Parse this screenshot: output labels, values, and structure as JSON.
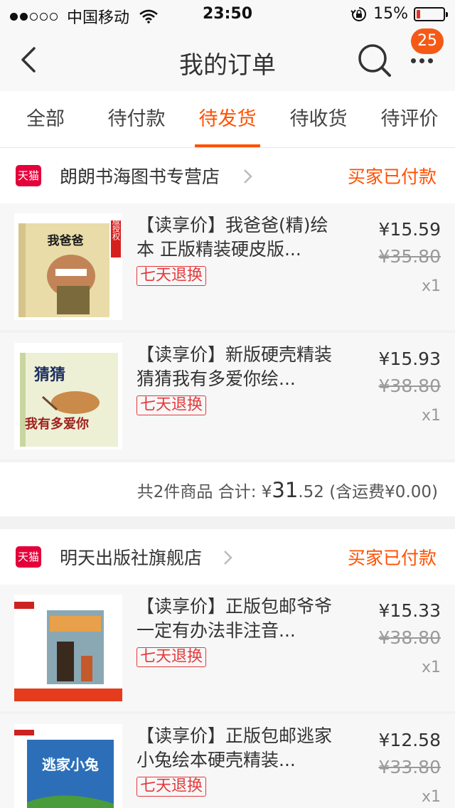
{
  "status_bar": {
    "carrier": "中国移动",
    "time": "23:50",
    "battery_percent": "15%",
    "battery_level": 0.15,
    "icons": [
      "signal-dots-icon",
      "wifi-icon",
      "rotation-lock-icon",
      "battery-icon"
    ]
  },
  "nav": {
    "title": "我的订单",
    "badge_count": "25",
    "icons": [
      "back-chevron-icon",
      "search-icon",
      "more-icon"
    ]
  },
  "tabs": [
    {
      "label": "全部",
      "active": false
    },
    {
      "label": "待付款",
      "active": false
    },
    {
      "label": "待发货",
      "active": true
    },
    {
      "label": "待收货",
      "active": false
    },
    {
      "label": "待评价",
      "active": false
    }
  ],
  "orders": [
    {
      "shop_badge": "天猫",
      "shop_name": "朗朗书海图书专营店",
      "status": "买家已付款",
      "items": [
        {
          "title": "【读享价】我爸爸(精)绘本 正版精装硬皮版...",
          "return_tag": "七天退换",
          "price": "¥15.59",
          "original_price": "¥35.80",
          "qty": "x1",
          "cover_text": "我爸爸",
          "cover_side_text": "正版授权"
        },
        {
          "title": "【读享价】新版硬壳精装 猜猜我有多爱你绘...",
          "return_tag": "七天退换",
          "price": "¥15.93",
          "original_price": "¥38.80",
          "qty": "x1",
          "cover_text": "猜猜",
          "cover_text2": "我有多爱你"
        }
      ],
      "summary": {
        "count_text": "共2件商品 合计:",
        "currency": "¥",
        "total_int": "31",
        "total_dec": ".52",
        "shipping": "(含运费¥0.00)"
      }
    },
    {
      "shop_badge": "天猫",
      "shop_name": "明天出版社旗舰店",
      "status": "买家已付款",
      "items": [
        {
          "title": "【读享价】正版包邮爷爷一定有办法非注音...",
          "return_tag": "七天退换",
          "price": "¥15.33",
          "original_price": "¥38.80",
          "qty": "x1"
        },
        {
          "title": "【读享价】正版包邮逃家小兔绘本硬壳精装...",
          "return_tag": "七天退换",
          "price": "¥12.58",
          "original_price": "¥33.80",
          "qty": "x1",
          "cover_text": "逃家小兔"
        }
      ]
    }
  ],
  "colors": {
    "accent": "#ff5000",
    "tmall_red": "#e4003a",
    "badge": "#f45a16",
    "tag_red": "#e4393c"
  }
}
